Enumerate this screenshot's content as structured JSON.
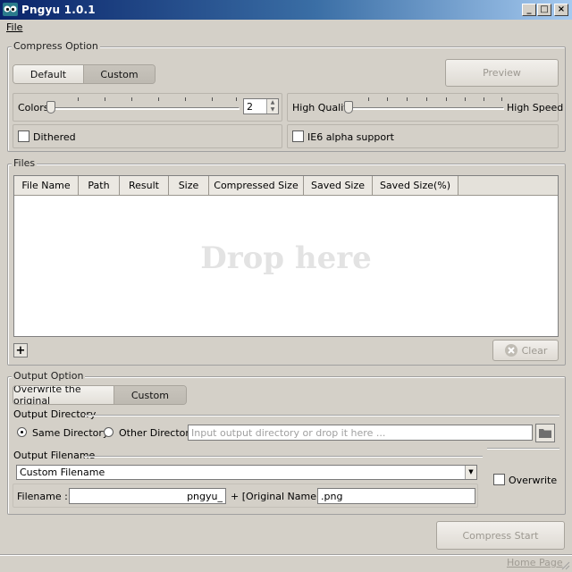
{
  "window": {
    "title": "Pngyu 1.0.1",
    "minimize_glyph": "_",
    "maximize_glyph": "□",
    "close_glyph": "×"
  },
  "menu": {
    "file_label": "File"
  },
  "compress_option": {
    "title": "Compress Option",
    "default_label": "Default",
    "custom_label": "Custom",
    "selected": "Custom",
    "preview_label": "Preview",
    "colors_label": "Colors",
    "colors_value": "2",
    "high_quality_label": "High Quality",
    "high_speed_label": "High Speed",
    "dithered_label": "Dithered",
    "dithered_checked": false,
    "ie6_label": "IE6 alpha support",
    "ie6_checked": false
  },
  "files": {
    "title": "Files",
    "columns": [
      "File Name",
      "Path",
      "Result",
      "Size",
      "Compressed Size",
      "Saved Size",
      "Saved Size(%)"
    ],
    "rows": [],
    "drop_text": "Drop here",
    "add_label": "+",
    "clear_label": "Clear"
  },
  "output_option": {
    "title": "Output Option",
    "overwrite_original_label": "Overwrite the original",
    "custom_label": "Custom",
    "selected": "Custom",
    "directory_title": "Output Directory",
    "same_dir_label": "Same Directory",
    "other_dir_label": "Other Directory",
    "directory_selected": "Same Directory",
    "directory_placeholder": "Input output directory or drop it here ...",
    "filename_title": "Output Filename",
    "filename_mode": "Custom Filename",
    "overwrite_label": "Overwrite",
    "overwrite_checked": false,
    "filename_label": "Filename :",
    "prefix_value": "pngyu_",
    "original_name_label": "+ [Original Name] +",
    "suffix_value": ".png"
  },
  "footer": {
    "compress_start_label": "Compress Start",
    "home_page_label": "Home Page"
  },
  "colors": {
    "titlebar_start": "#0a246a",
    "titlebar_end": "#a6caf0",
    "window_bg": "#d4d0c8"
  }
}
